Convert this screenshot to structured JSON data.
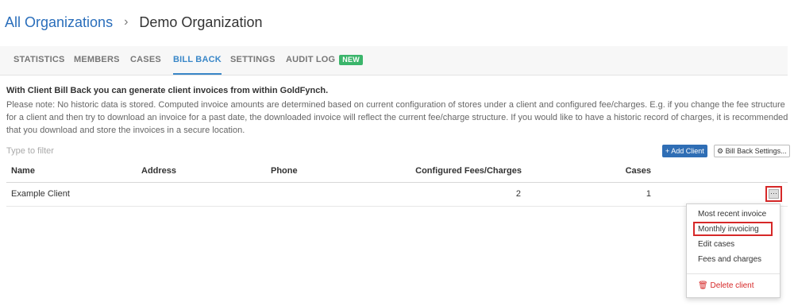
{
  "breadcrumb": {
    "parent": "All Organizations",
    "separator": "›",
    "current": "Demo Organization"
  },
  "tabs": [
    {
      "label": "STATISTICS"
    },
    {
      "label": "MEMBERS"
    },
    {
      "label": "CASES"
    },
    {
      "label": "BILL BACK",
      "active": true
    },
    {
      "label": "SETTINGS"
    },
    {
      "label": "AUDIT LOG",
      "badge": "NEW"
    }
  ],
  "intro": "With Client Bill Back you can generate client invoices from within GoldFynch.",
  "note": "Please note: No historic data is stored. Computed invoice amounts are determined based on current configuration of stores under a client and configured fee/charges. E.g. if you change the fee structure for a client and then try to download an invoice for a past date, the downloaded invoice will reflect the current fee/charge structure. If you would like to have a historic record of charges, it is recommended that you download and store the invoices in a secure location.",
  "filter": {
    "placeholder": "Type to filter",
    "value": ""
  },
  "buttons": {
    "add_client": "+ Add Client",
    "settings": "⚙ Bill Back Settings..."
  },
  "table": {
    "columns": [
      "Name",
      "Address",
      "Phone",
      "Configured Fees/Charges",
      "Cases"
    ],
    "rows": [
      {
        "name": "Example Client",
        "address": "",
        "phone": "",
        "fees": "2",
        "cases": "1"
      }
    ],
    "more_label": "···"
  },
  "menu": {
    "items": [
      "Most recent invoice",
      "Monthly invoicing",
      "Edit cases",
      "Fees and charges"
    ],
    "delete": "🗑 Delete client"
  },
  "colors": {
    "link": "#2a6ebb",
    "active_tab": "#3a87c8",
    "primary": "#2f6eb5",
    "badge": "#3bb56b",
    "highlight": "#d62828"
  },
  "icons": [
    "chevron-right-icon",
    "gear-icon",
    "trash-icon",
    "ellipsis-icon"
  ]
}
